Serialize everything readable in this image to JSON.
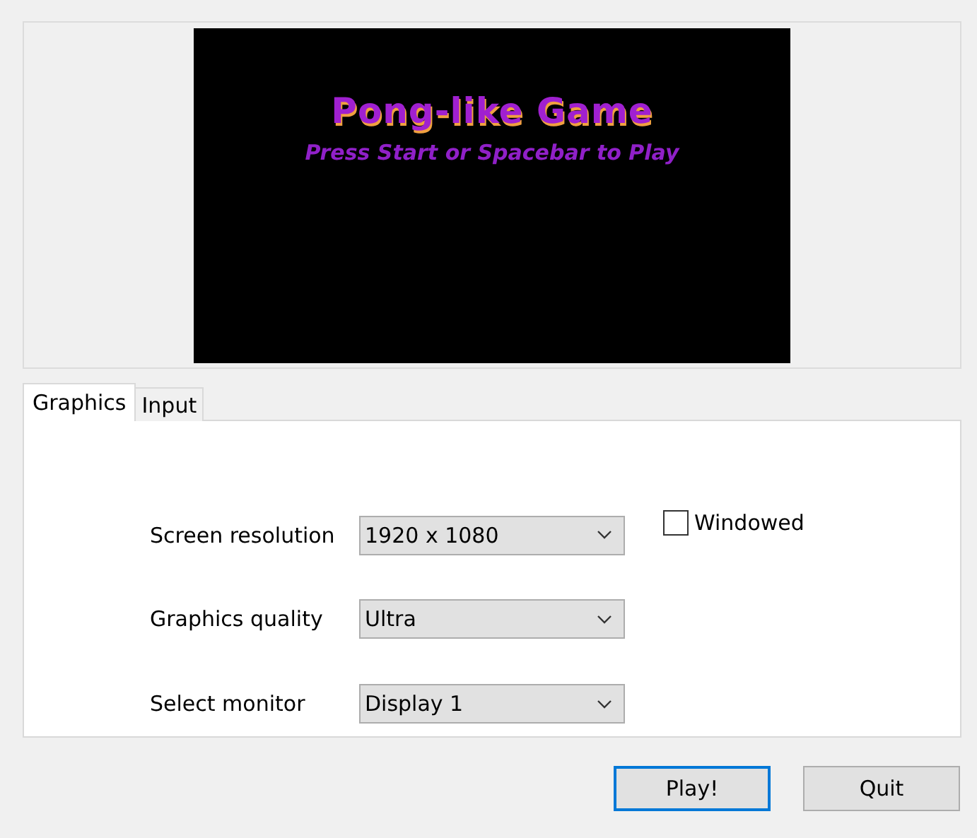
{
  "banner": {
    "title": "Pong-like Game",
    "subtitle": "Press Start or Spacebar to Play"
  },
  "tabs": [
    {
      "label": "Graphics",
      "selected": true
    },
    {
      "label": "Input",
      "selected": false
    }
  ],
  "settings": [
    {
      "label": "Screen resolution",
      "value": "1920 x 1080"
    },
    {
      "label": "Graphics quality",
      "value": "Ultra"
    },
    {
      "label": "Select monitor",
      "value": "Display 1"
    }
  ],
  "windowed": {
    "label": "Windowed",
    "checked": false
  },
  "buttons": [
    {
      "label": "Play!",
      "default": true
    },
    {
      "label": "Quit",
      "default": false
    }
  ]
}
